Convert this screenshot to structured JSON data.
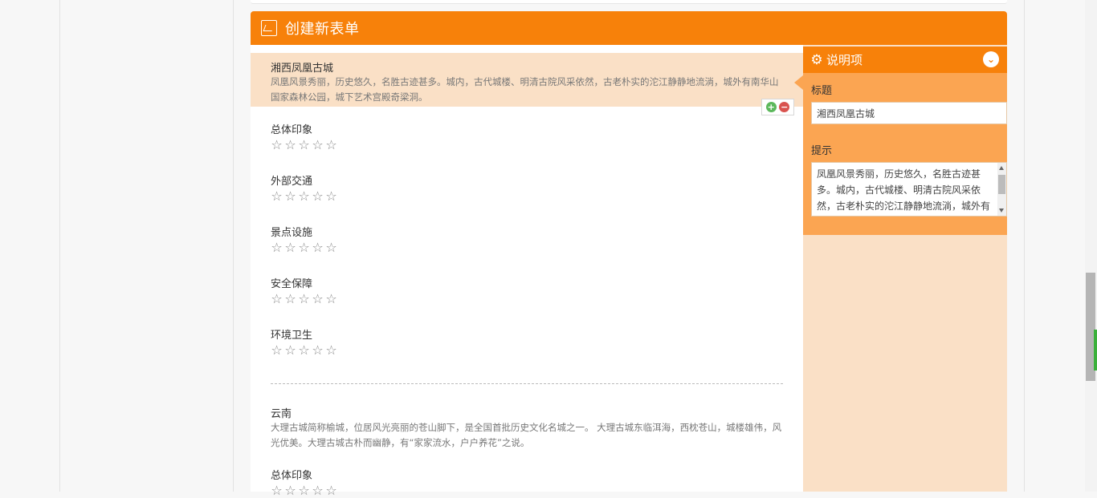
{
  "header": {
    "title": "创建新表单"
  },
  "selected_block": {
    "title": "湘西凤凰古城",
    "description": "凤凰风景秀丽，历史悠久，名胜古迹甚多。城内，古代城楼、明清古院风采依然，古老朴实的沱江静静地流淌，城外有南华山国家森林公园，城下艺术宫殿奇梁洞。"
  },
  "ratings_1": [
    {
      "label": "总体印象"
    },
    {
      "label": "外部交通"
    },
    {
      "label": "景点设施"
    },
    {
      "label": "安全保障"
    },
    {
      "label": "环境卫生"
    }
  ],
  "block2": {
    "title": "云南",
    "description": "大理古城简称榆城，位居风光亮丽的苍山脚下，是全国首批历史文化名城之一。 大理古城东临洱海，西枕苍山，城楼雄伟，风光优美。大理古城古朴而幽静，有“家家流水，户户养花”之说。",
    "rating_label": "总体印象"
  },
  "props_panel": {
    "title": "说明项",
    "title_label": "标题",
    "title_value": "湘西凤凰古城",
    "hint_label": "提示",
    "hint_value": "凤凰风景秀丽，历史悠久，名胜古迹甚多。城内，古代城楼、明清古院风采依然，古老朴实的沱江静静地流淌，城外有南华"
  },
  "icons": {
    "header": "form-icon",
    "gear": "gear-icon",
    "collapse": "chevron-down-icon",
    "add": "plus-circle-icon",
    "remove": "minus-circle-icon",
    "star": "star-outline-icon"
  },
  "colors": {
    "accent": "#f7810a",
    "panel": "#fba552",
    "selected_bg": "#fae0c6"
  }
}
